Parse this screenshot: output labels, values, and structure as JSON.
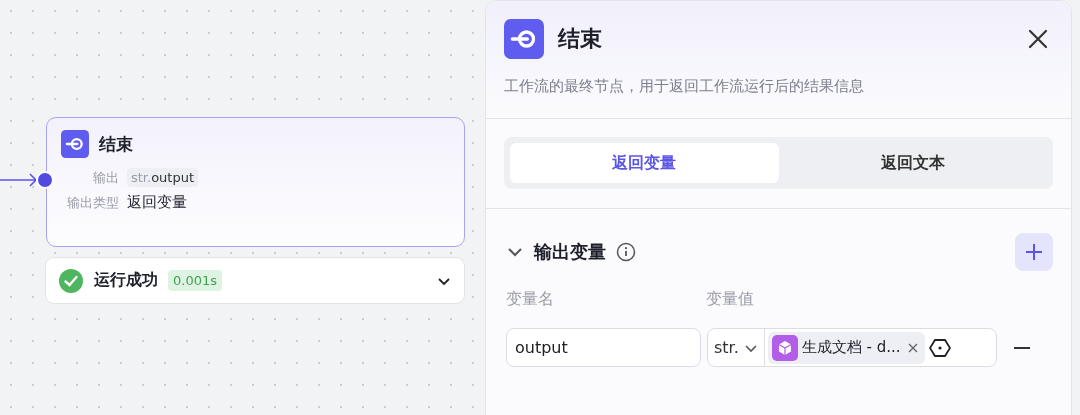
{
  "node": {
    "title": "结束",
    "fields": [
      {
        "label": "输出",
        "kind": "tag",
        "type": "str.",
        "value": "output"
      },
      {
        "label": "输出类型",
        "kind": "text",
        "value": "返回变量"
      }
    ]
  },
  "run_status": {
    "label": "运行成功",
    "duration": "0.001s",
    "success": true,
    "expanded": false
  },
  "panel": {
    "title": "结束",
    "description": "工作流的最终节点，用于返回工作流运行后的结果信息",
    "tabs": [
      {
        "label": "返回变量",
        "selected": true
      },
      {
        "label": "返回文本",
        "selected": false
      }
    ],
    "section": {
      "title": "输出变量",
      "expanded": true,
      "columns": [
        "变量名",
        "变量值"
      ],
      "rows": [
        {
          "name": "output",
          "type": "str.",
          "reference": "生成文档 - d..."
        }
      ]
    }
  }
}
